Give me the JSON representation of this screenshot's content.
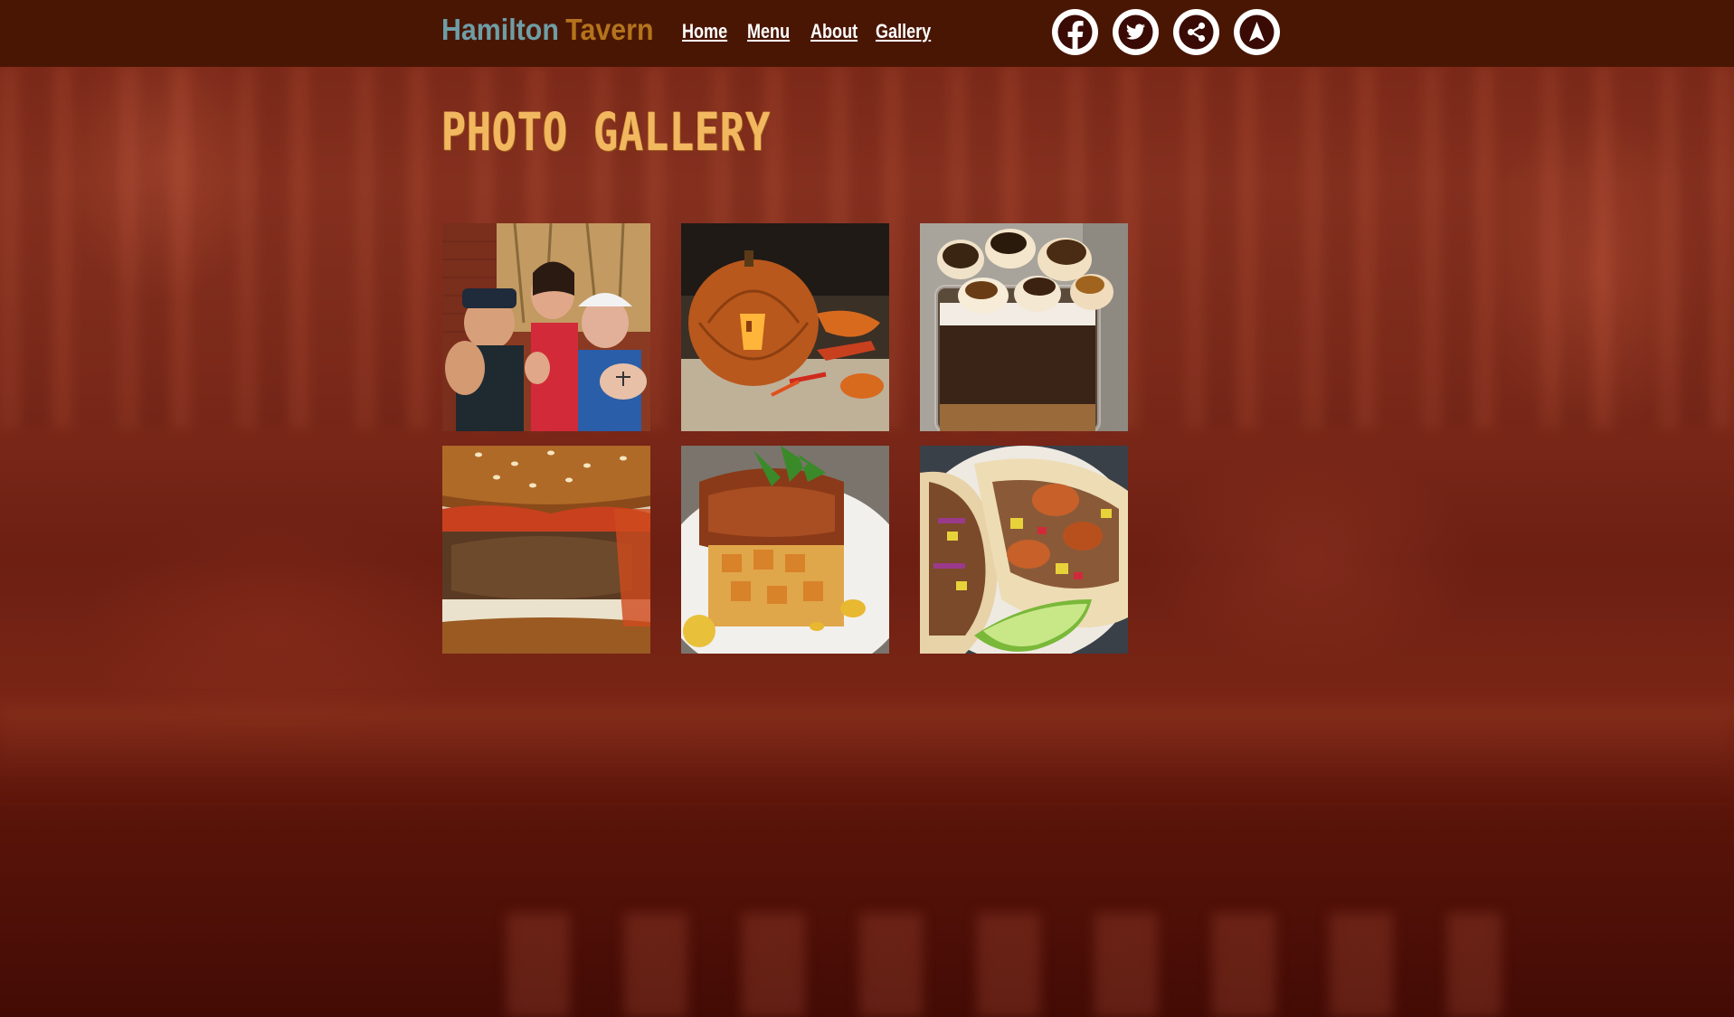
{
  "site": {
    "name_part1": "Hamilton",
    "name_part2": "Tavern"
  },
  "nav": {
    "items": [
      {
        "label": "Home"
      },
      {
        "label": "Menu"
      },
      {
        "label": "About"
      },
      {
        "label": "Gallery"
      }
    ]
  },
  "social": {
    "icons": [
      "facebook-icon",
      "twitter-icon",
      "share-icon",
      "navigation-arrow-icon"
    ]
  },
  "page": {
    "title": "PHOTO GALLERY"
  },
  "gallery": {
    "photos": [
      {
        "subject": "three people in costumes with flexed arms"
      },
      {
        "subject": "carved jack-o-lantern pumpkin"
      },
      {
        "subject": "jar dessert topped with toasted marshmallows"
      },
      {
        "subject": "burger with kimchi on sesame bun"
      },
      {
        "subject": "plated chicken with mango salsa and arugula"
      },
      {
        "subject": "shrimp tacos with lime wedge"
      }
    ]
  },
  "colors": {
    "header_bg": "#4a1604",
    "brand_primary": "#6e9ea6",
    "brand_accent": "#b4741c",
    "title": "#f2b860",
    "nav_text": "#ffffff"
  }
}
